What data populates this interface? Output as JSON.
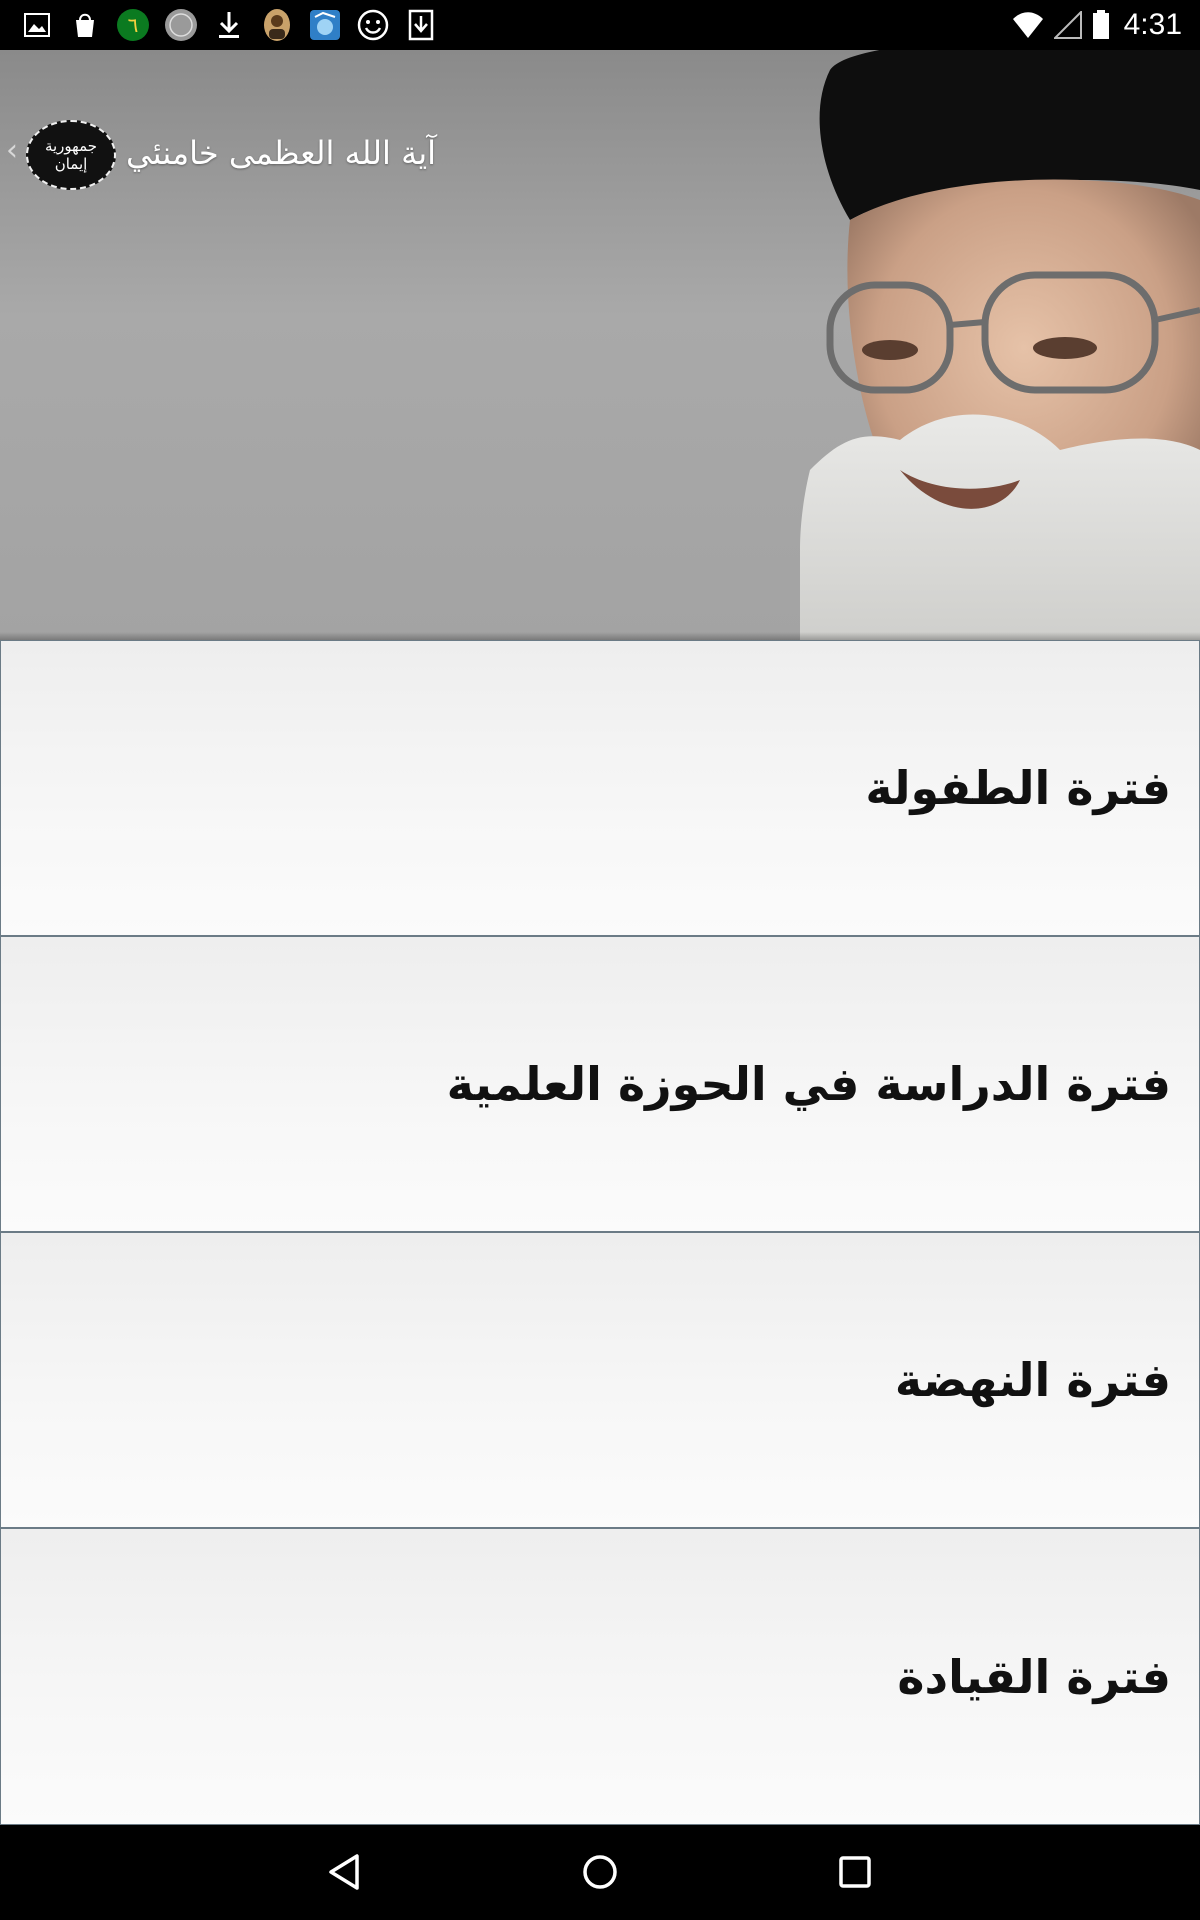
{
  "status_bar": {
    "time": "4:31",
    "notification_icons": [
      "gallery-icon",
      "shopping-bag-icon",
      "number-six-icon",
      "coin-icon",
      "download-icon",
      "portrait-icon",
      "photo-app-icon",
      "smiley-icon",
      "download-box-icon"
    ],
    "status_icons": [
      "wifi-icon",
      "cell-signal-icon",
      "battery-icon"
    ]
  },
  "header": {
    "title": "آية الله العظمى خامنئي",
    "logo_line1": "جمهورية",
    "logo_line2": "إيمان"
  },
  "menu": {
    "items": [
      {
        "label": "فترة الطفولة"
      },
      {
        "label": "فترة الدراسة في الحوزة العلمية"
      },
      {
        "label": "فترة النهضة"
      },
      {
        "label": "فترة القيادة"
      }
    ]
  },
  "nav_bar": {
    "buttons": [
      "back-icon",
      "home-icon",
      "recents-icon"
    ]
  }
}
